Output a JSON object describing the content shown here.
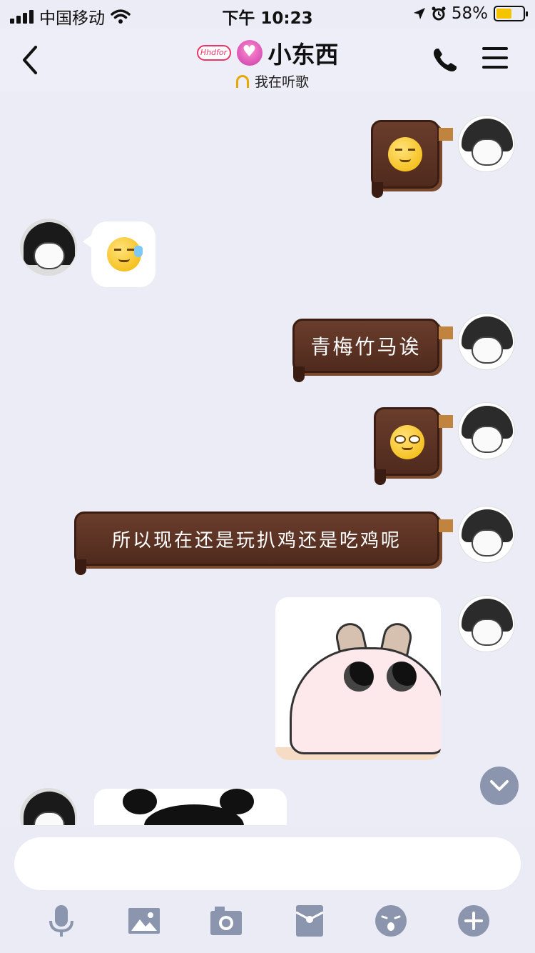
{
  "status_bar": {
    "carrier": "中国移动",
    "time": "下午 10:23",
    "battery_percent": "58%",
    "battery_level": 0.58,
    "icons": [
      "signal-icon",
      "wifi-icon",
      "location-icon",
      "alarm-icon",
      "battery-charging-icon"
    ]
  },
  "header": {
    "title": "小东西",
    "status": "我在听歌",
    "icons": [
      "back-icon",
      "name-badge-icon",
      "heart-badge-icon",
      "headphone-icon",
      "phone-icon",
      "menu-icon"
    ],
    "badge1_text": "Hhdfor"
  },
  "messages": [
    {
      "side": "right",
      "type": "emoji",
      "emoji": "thinking-face"
    },
    {
      "side": "left",
      "type": "emoji",
      "emoji": "sweat-face"
    },
    {
      "side": "right",
      "type": "text",
      "text": "青梅竹马诶"
    },
    {
      "side": "right",
      "type": "emoji",
      "emoji": "smirk-face"
    },
    {
      "side": "right",
      "type": "text",
      "text": "所以现在还是玩扒鸡还是吃鸡呢"
    },
    {
      "side": "right",
      "type": "sticker",
      "sticker": "cat-sticker"
    },
    {
      "side": "left",
      "type": "sticker",
      "sticker": "black-blob-sticker"
    }
  ],
  "input": {
    "placeholder": "",
    "value": ""
  },
  "toolbar": [
    "microphone-icon",
    "image-icon",
    "camera-icon",
    "red-packet-icon",
    "emoji-icon",
    "plus-icon"
  ]
}
